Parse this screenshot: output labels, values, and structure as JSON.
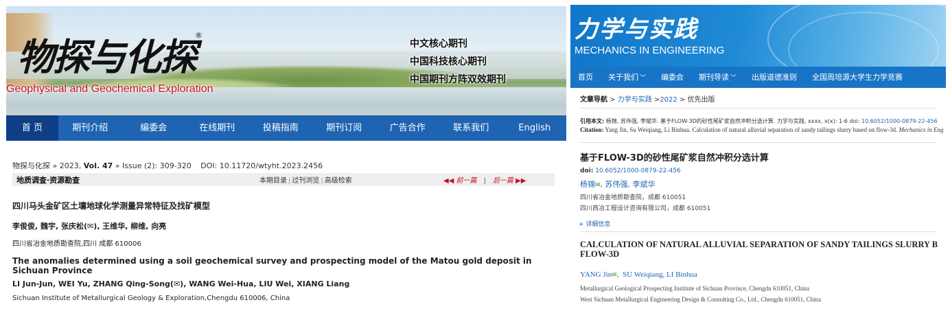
{
  "left": {
    "banner": {
      "logo_cn": "物探与化探",
      "registered": "®",
      "logo_en": "Geophysical and Geochemical Exploration",
      "core_lines": [
        "中文核心期刊",
        "中国科技核心期刊",
        "中国期刊方阵双效期刊"
      ]
    },
    "nav": [
      "首 页",
      "期刊介绍",
      "编委会",
      "在线期刊",
      "投稿指南",
      "期刊订阅",
      "广告合作",
      "联系我们",
      "English"
    ],
    "info": {
      "journal": "物探与化探",
      "year": "2023,",
      "vol_label": "Vol. 47",
      "issue": "Issue (2): 309-320",
      "doi": "DOI: 10.11720/wtyht.2023.2456"
    },
    "section": {
      "title": "地质调查·资源勘查",
      "tools": [
        "本期目录",
        "过刊浏览",
        "高级检索"
      ],
      "prev": "◀◀ 前一篇",
      "next": "后一篇 ▶▶"
    },
    "article": {
      "title_cn": "四川马头金矿区土壤地球化学测量异常特征及找矿模型",
      "authors_cn": "李俊俊, 魏宇, 张庆松(✉), 王维华, 柳维, 向亮",
      "affil_cn_a": "四川省冶金地质勘查院,四川",
      "affil_cn_b": "成都 610006",
      "title_en": "The anomalies determined using a soil geochemical survey and prospecting model of the Matou gold deposit in Sichuan Province",
      "authors_en": "LI Jun-Jun, WEI Yu, ZHANG Qing-Song(✉), WANG Wei-Hua, LIU Wei, XIANG Liang",
      "affil_en": "Sichuan Institute of Metallurgical Geology & Exploration,Chengdu 610006, China"
    }
  },
  "right": {
    "banner": {
      "logo_cn": "力学与实践",
      "logo_en": "MECHANICS IN ENGINEERING"
    },
    "nav": [
      {
        "label": "首页",
        "dropdown": false
      },
      {
        "label": "关于我们",
        "dropdown": true
      },
      {
        "label": "编委会",
        "dropdown": false
      },
      {
        "label": "期刊导读",
        "dropdown": true
      },
      {
        "label": "出版道德准则",
        "dropdown": false
      },
      {
        "label": "全国周培源大学生力学竞赛",
        "dropdown": false
      }
    ],
    "breadcrumb": {
      "label": "文章导航",
      "sep1": " > ",
      "journal": "力学与实践",
      "sep2": " >",
      "year": "2022",
      "sep3": " > ",
      "current": "优先出版"
    },
    "citation": {
      "cn_label": "引用本文:",
      "cn_text": "杨锦, 苏伟强, 李斌华. 基于FLOW-3D的砂性尾矿浆自然冲积分选计算. 力学与实践, xxxx, x(x): 1-6 doi:",
      "cn_doi": "10.6052/1000-0879-22-456",
      "en_label": "Citation:",
      "en_text": "Yang Jin, Su Weiqiang, Li Binhua. Calculation of natural alluvial separation of sandy tailings slurry based on flow-3d.",
      "en_journal": "Mechanics in Engineering"
    },
    "article": {
      "title_cn": "基于FLOW-3D的砂性尾矿浆自然冲积分选计算",
      "doi_label": "doi:",
      "doi": "10.6052/1000-0879-22-456",
      "author1_cn": "杨锦",
      "authors_rest_cn": "苏伟强, 李斌华",
      "affil1_cn": "四川省冶金地质勘查院，成都 610051",
      "affil2_cn": "四川西冶工程设计咨询有限公司，成都 610051",
      "detail_link": "+ 详细信息",
      "title_en_1": "CALCULATION OF NATURAL ALLUVIAL SEPARATION OF SANDY TAILINGS SLURRY B",
      "title_en_2": "FLOW-3D",
      "author1_en": "YANG Jin",
      "authors_rest_en": "SU Weiqiang,   LI Binhua",
      "affil1_en": "Metallurgical Geological Prospecting Institute of Sichuan Province, Chengdu 610051, China",
      "affil2_en": "West Sichuan Metallurgical Engineering Design & Consulting Co., Ltd., Chengdu 610051, China"
    }
  }
}
